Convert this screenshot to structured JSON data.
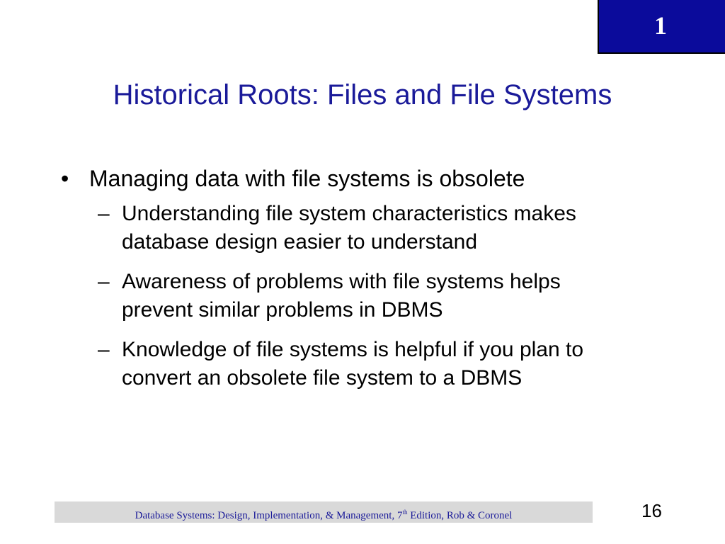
{
  "badge": {
    "chapter": "1",
    "color": "#0b0b9b"
  },
  "slide": {
    "title": "Historical Roots: Files and File Systems",
    "title_color": "#1a1a99",
    "bullet": {
      "marker": "•",
      "text": "Managing data with file systems is obsolete"
    },
    "sub_marker": "–",
    "sub_items": [
      "Understanding file system characteristics makes database design easier to understand",
      "Awareness of problems with file systems helps prevent similar problems in DBMS",
      "Knowledge of file systems is helpful if you plan to convert an obsolete file system to a DBMS"
    ]
  },
  "footer": {
    "text_before_sup": "Database Systems: Design, Implementation, & Management, 7",
    "sup": "th",
    "text_after_sup": " Edition, Rob & Coronel",
    "page_number": "16"
  }
}
